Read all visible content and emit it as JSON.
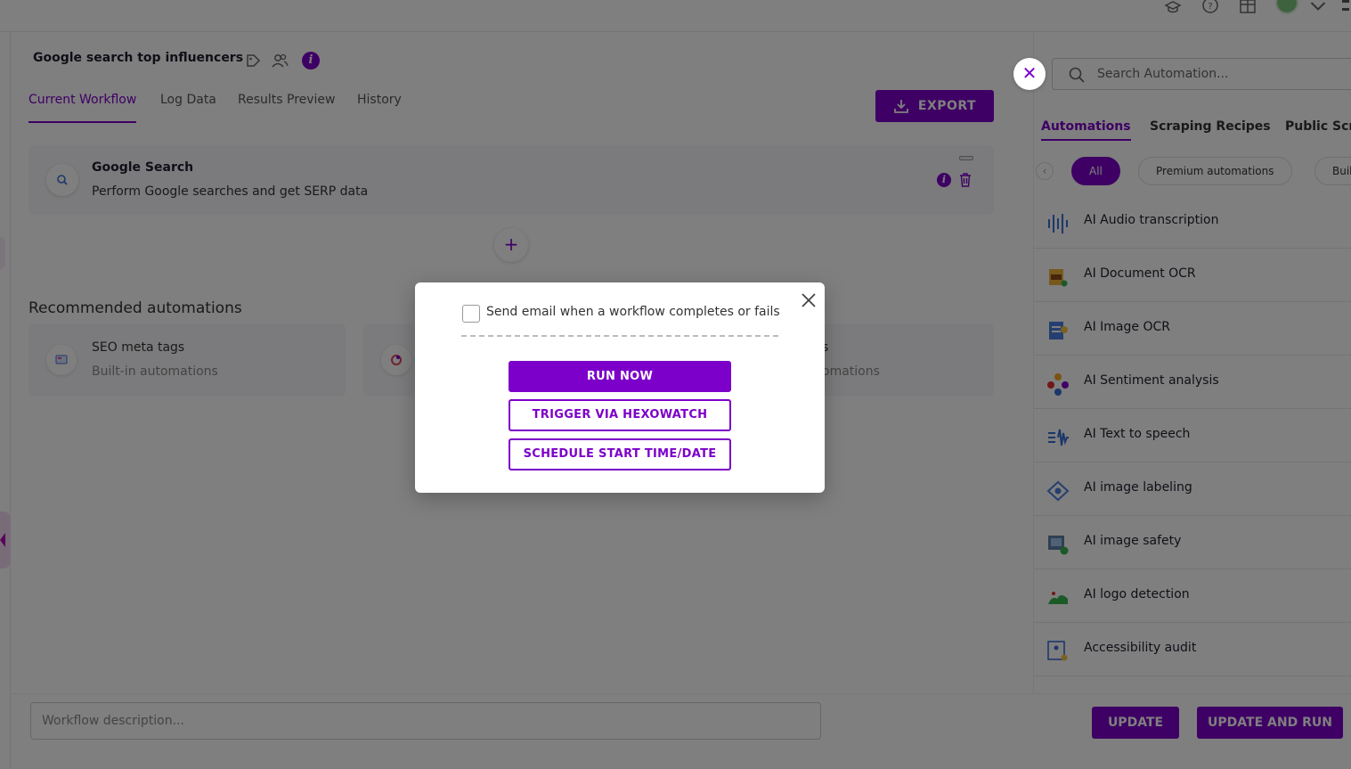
{
  "workflow": {
    "title": "Google search top influencers",
    "tabs": [
      "Current Workflow",
      "Log Data",
      "Results Preview",
      "History"
    ],
    "export_label": "EXPORT",
    "step": {
      "title": "Google Search",
      "description": "Perform Google searches and get SERP data"
    },
    "recommended": {
      "heading": "Recommended automations",
      "items": [
        {
          "title": "SEO meta tags",
          "subtitle": "Built-in automations"
        },
        {
          "title": "",
          "subtitle": ""
        },
        {
          "title": "s",
          "subtitle": "omations"
        }
      ]
    }
  },
  "panel": {
    "search_placeholder": "Search Automation...",
    "tabs": [
      "Automations",
      "Scraping Recipes",
      "Public Scra"
    ],
    "chips": [
      "All",
      "Premium automations",
      "Buil"
    ],
    "items": [
      {
        "label": "AI Audio transcription",
        "icon": "audio-wave-icon"
      },
      {
        "label": "AI Document OCR",
        "icon": "document-ocr-icon"
      },
      {
        "label": "AI Image OCR",
        "icon": "image-ocr-icon"
      },
      {
        "label": "AI Sentiment analysis",
        "icon": "sentiment-icon"
      },
      {
        "label": "AI Text to speech",
        "icon": "text-to-speech-icon"
      },
      {
        "label": "AI image labeling",
        "icon": "image-label-icon"
      },
      {
        "label": "AI image safety",
        "icon": "image-safety-icon"
      },
      {
        "label": "AI logo detection",
        "icon": "logo-detection-icon"
      },
      {
        "label": "Accessibility audit",
        "icon": "accessibility-icon"
      }
    ]
  },
  "bottom": {
    "description_placeholder": "Workflow description...",
    "update_label": "UPDATE",
    "update_run_label": "UPDATE AND RUN"
  },
  "modal": {
    "checkbox_label": "Send email when a workflow completes or fails",
    "run_now": "RUN NOW",
    "trigger": "TRIGGER VIA HEXOWATCH",
    "schedule": "SCHEDULE START TIME/DATE"
  },
  "colors": {
    "accent": "#7c00c9",
    "overlay": "rgba(0,0,0,0.5)"
  }
}
